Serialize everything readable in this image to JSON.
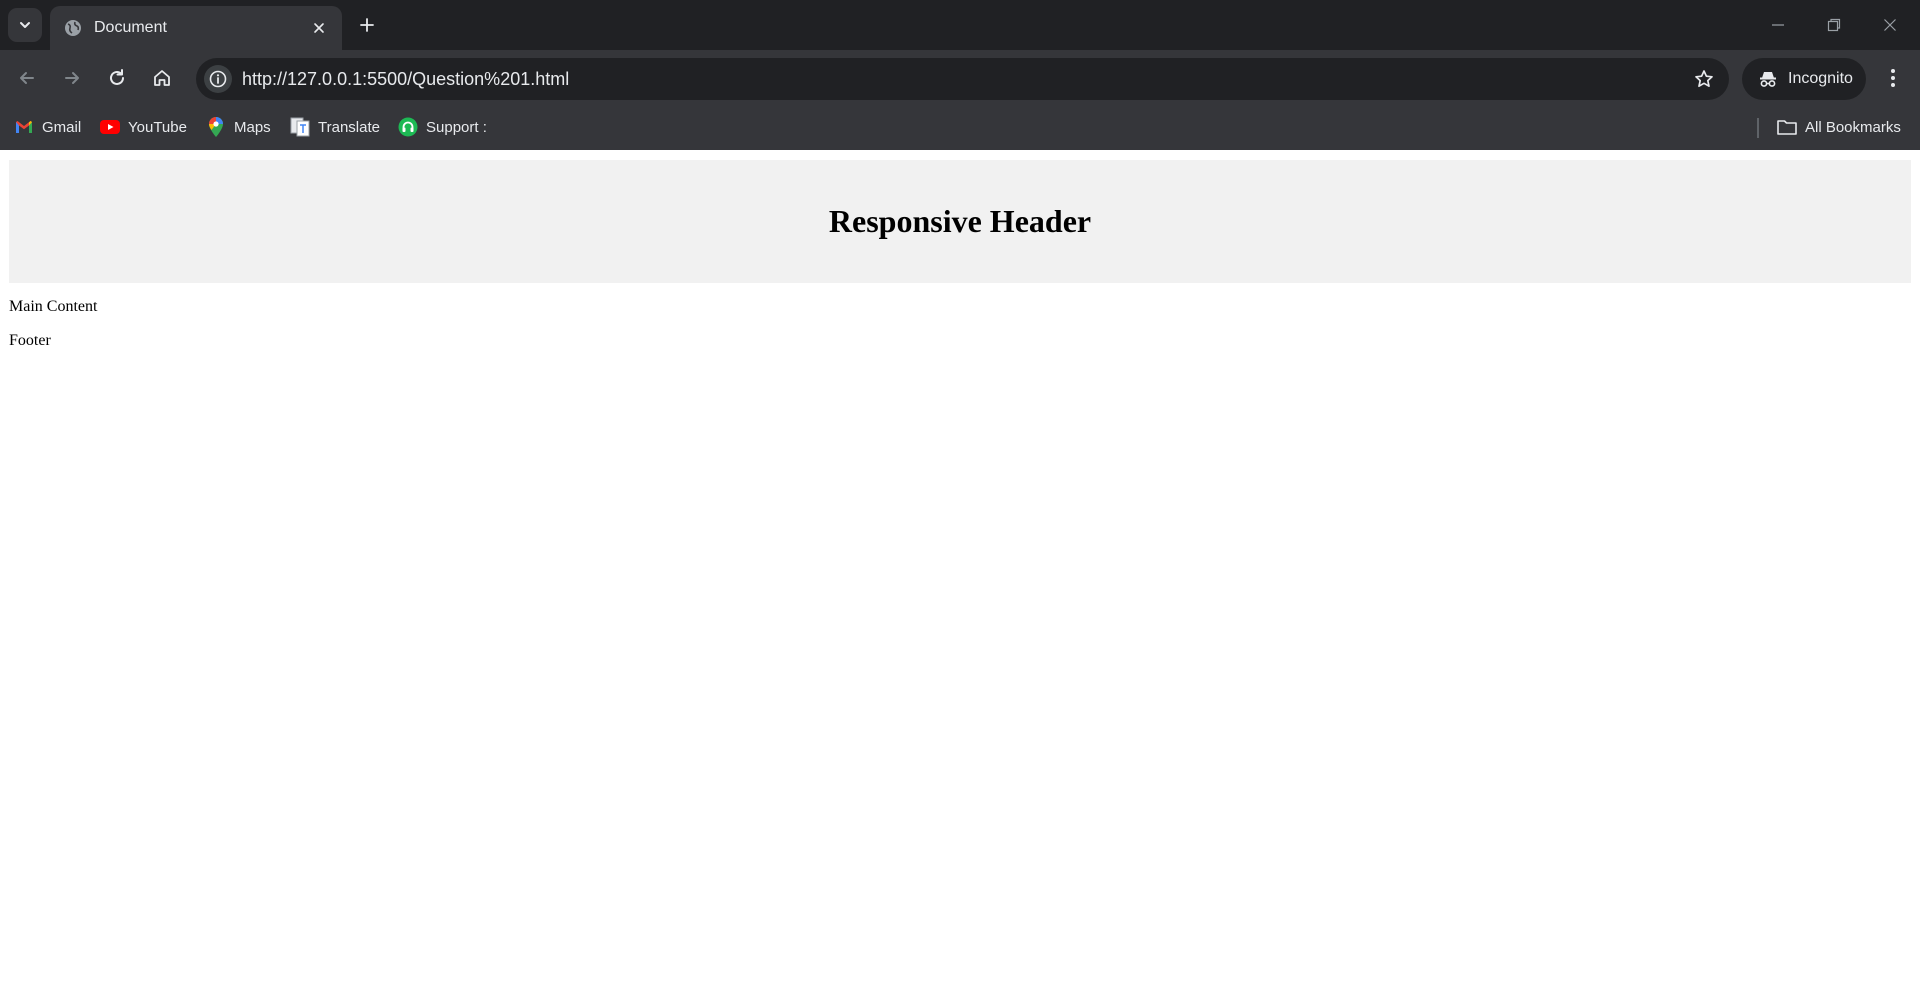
{
  "browser": {
    "tab": {
      "title": "Document"
    },
    "address_bar": {
      "url": "http://127.0.0.1:5500/Question%201.html"
    },
    "profile": {
      "label": "Incognito"
    },
    "bookmarks": [
      {
        "label": "Gmail",
        "icon": "gmail-icon"
      },
      {
        "label": "YouTube",
        "icon": "youtube-icon"
      },
      {
        "label": "Maps",
        "icon": "maps-icon"
      },
      {
        "label": "Translate",
        "icon": "translate-icon"
      },
      {
        "label": "Support :",
        "icon": "support-icon"
      }
    ],
    "all_bookmarks_label": "All Bookmarks",
    "colors": {
      "frame": "#202124",
      "toolbar": "#35363a",
      "text": "#e8eaed"
    }
  },
  "page": {
    "header": {
      "title": "Responsive Header",
      "background": "#f1f1f1"
    },
    "main": {
      "text": "Main Content"
    },
    "footer": {
      "text": "Footer"
    }
  }
}
